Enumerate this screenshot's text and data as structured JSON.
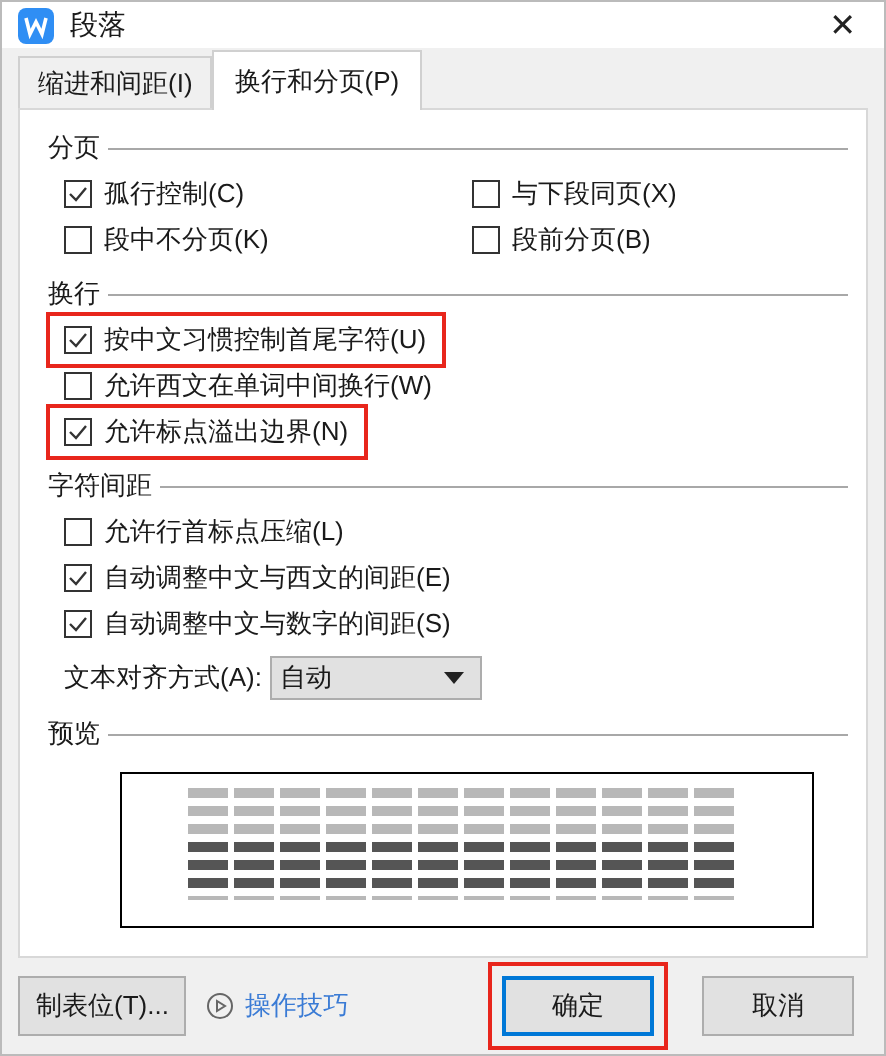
{
  "window": {
    "title": "段落",
    "close": "✕"
  },
  "tabs": [
    {
      "label": "缩进和间距(I)",
      "selected": false
    },
    {
      "label": "换行和分页(P)",
      "selected": true
    }
  ],
  "groups": [
    {
      "title": "分页",
      "kind": "grid",
      "options": [
        {
          "label": "孤行控制(C)",
          "checked": true,
          "highlighted": false
        },
        {
          "label": "与下段同页(X)",
          "checked": false,
          "highlighted": false
        },
        {
          "label": "段中不分页(K)",
          "checked": false,
          "highlighted": false
        },
        {
          "label": "段前分页(B)",
          "checked": false,
          "highlighted": false
        }
      ]
    },
    {
      "title": "换行",
      "kind": "list",
      "options": [
        {
          "label": "按中文习惯控制首尾字符(U)",
          "checked": true,
          "highlighted": true
        },
        {
          "label": "允许西文在单词中间换行(W)",
          "checked": false,
          "highlighted": false
        },
        {
          "label": "允许标点溢出边界(N)",
          "checked": true,
          "highlighted": true
        }
      ]
    },
    {
      "title": "字符间距",
      "kind": "list",
      "options": [
        {
          "label": "允许行首标点压缩(L)",
          "checked": false,
          "highlighted": false
        },
        {
          "label": "自动调整中文与西文的间距(E)",
          "checked": true,
          "highlighted": false
        },
        {
          "label": "自动调整中文与数字的间距(S)",
          "checked": true,
          "highlighted": false
        }
      ],
      "select": {
        "label": "文本对齐方式(A):",
        "value": "自动"
      }
    }
  ],
  "preview": {
    "title": "预览"
  },
  "footer": {
    "tabs_button": "制表位(T)...",
    "tips_link": "操作技巧",
    "buttons": [
      {
        "label": "确定",
        "default": true,
        "highlighted": true
      },
      {
        "label": "取消",
        "default": false,
        "highlighted": false
      }
    ]
  }
}
